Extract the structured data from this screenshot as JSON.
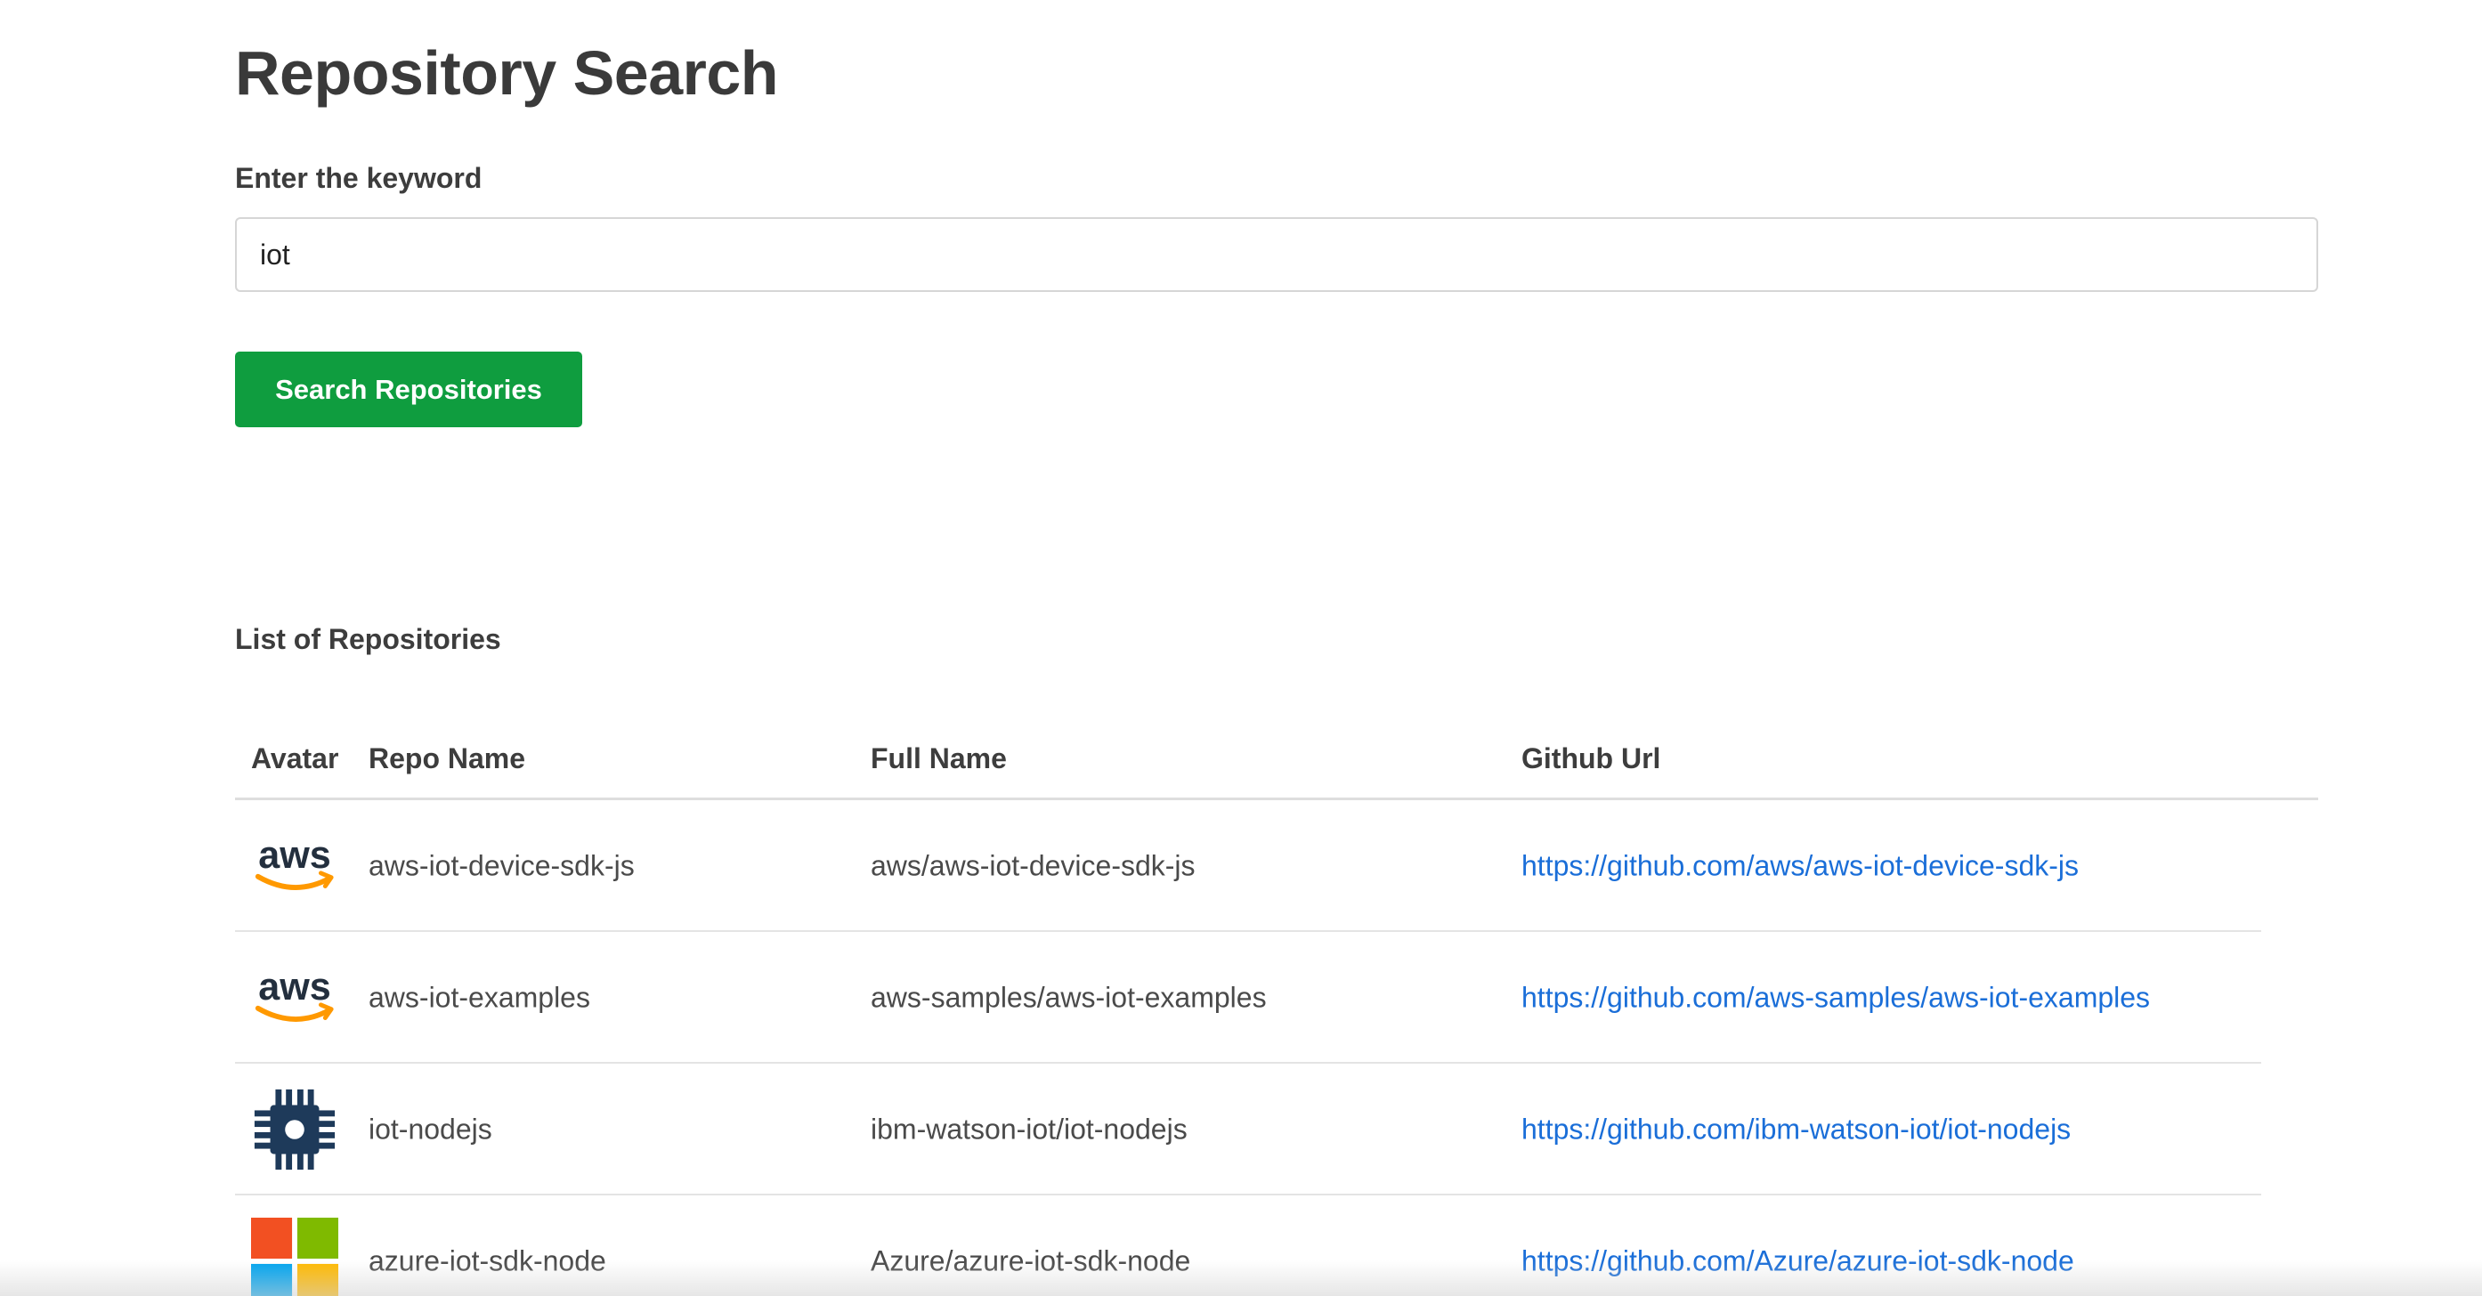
{
  "page": {
    "title": "Repository Search"
  },
  "search": {
    "label": "Enter the keyword",
    "value": "iot",
    "button_label": "Search Repositories"
  },
  "list": {
    "title": "List of Repositories",
    "columns": {
      "avatar": "Avatar",
      "repo_name": "Repo Name",
      "full_name": "Full Name",
      "url": "Github Url"
    },
    "rows": [
      {
        "avatar_icon": "aws-logo-icon",
        "repo_name": "aws-iot-device-sdk-js",
        "full_name": "aws/aws-iot-device-sdk-js",
        "url": "https://github.com/aws/aws-iot-device-sdk-js"
      },
      {
        "avatar_icon": "aws-logo-icon",
        "repo_name": "aws-iot-examples",
        "full_name": "aws-samples/aws-iot-examples",
        "url": "https://github.com/aws-samples/aws-iot-examples"
      },
      {
        "avatar_icon": "chip-icon",
        "repo_name": "iot-nodejs",
        "full_name": "ibm-watson-iot/iot-nodejs",
        "url": "https://github.com/ibm-watson-iot/iot-nodejs"
      },
      {
        "avatar_icon": "microsoft-logo-icon",
        "repo_name": "azure-iot-sdk-node",
        "full_name": "Azure/azure-iot-sdk-node",
        "url": "https://github.com/Azure/azure-iot-sdk-node"
      }
    ]
  },
  "colors": {
    "button_bg": "#0f9d3f",
    "link": "#1a6ed8",
    "aws_text": "#232f3e",
    "aws_smile": "#ff9900",
    "chip": "#1e3a5a",
    "ms_red": "#f25022",
    "ms_green": "#7fba00",
    "ms_blue": "#00a4ef",
    "ms_yellow": "#ffb900"
  }
}
